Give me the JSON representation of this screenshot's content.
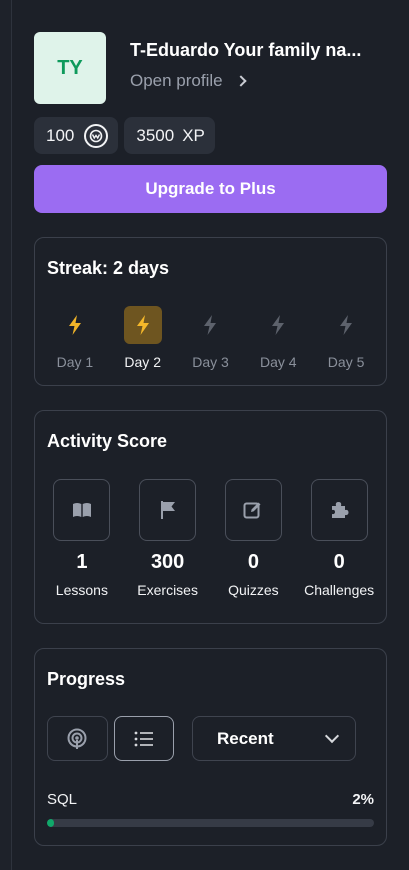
{
  "profile": {
    "initials": "TY",
    "name": "T-Eduardo Your family na...",
    "open_profile_label": "Open profile"
  },
  "stats": {
    "coins": "100",
    "xp_value": "3500",
    "xp_label": "XP"
  },
  "upgrade_label": "Upgrade to Plus",
  "streak": {
    "title": "Streak: 2 days",
    "days": [
      {
        "label": "Day 1",
        "state": "done"
      },
      {
        "label": "Day 2",
        "state": "today"
      },
      {
        "label": "Day 3",
        "state": "future"
      },
      {
        "label": "Day 4",
        "state": "future"
      },
      {
        "label": "Day 5",
        "state": "future"
      }
    ]
  },
  "activity": {
    "title": "Activity Score",
    "metrics": [
      {
        "icon": "book-icon",
        "value": "1",
        "label": "Lessons"
      },
      {
        "icon": "flag-icon",
        "value": "300",
        "label": "Exercises"
      },
      {
        "icon": "edit-icon",
        "value": "0",
        "label": "Quizzes"
      },
      {
        "icon": "puzzle-icon",
        "value": "0",
        "label": "Challenges"
      }
    ]
  },
  "progress": {
    "title": "Progress",
    "view_options": [
      "podcast-icon",
      "list-icon"
    ],
    "selected_view": "list-icon",
    "sort_value": "Recent",
    "courses": [
      {
        "name": "SQL",
        "percent_label": "2%",
        "percent": 2
      }
    ]
  },
  "colors": {
    "accent": "#9b6cf2",
    "streak_active": "#f0b429",
    "progress_fill": "#10a86a"
  }
}
